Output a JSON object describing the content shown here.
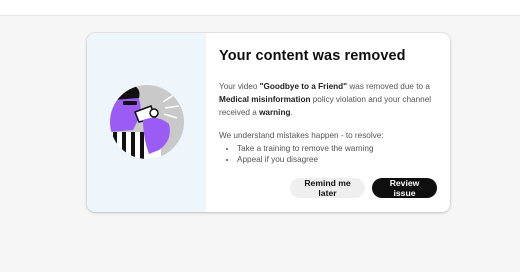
{
  "dialog": {
    "title": "Your content was removed",
    "message": {
      "prefix": "Your video ",
      "video_title": "\"Goodbye to a Friend\"",
      "middle": " was removed due to a ",
      "policy": "Medical misinformation",
      "suffix": " policy violation and your channel received a ",
      "penalty": "warning",
      "end": "."
    },
    "resolve_intro": "We understand mistakes happen - to resolve:",
    "resolve_steps": [
      "Take a training to remove the warning",
      "Appeal if you disagree"
    ],
    "buttons": {
      "secondary": "Remind me later",
      "primary": "Review issue"
    },
    "illustration_icon": "person-with-megaphone-icon"
  },
  "colors": {
    "art_panel_bg": "#eef5fb",
    "primary_button_bg": "#0f0f0f",
    "secondary_button_bg": "#efefef",
    "illustration_purple": "#9b5cf6"
  }
}
